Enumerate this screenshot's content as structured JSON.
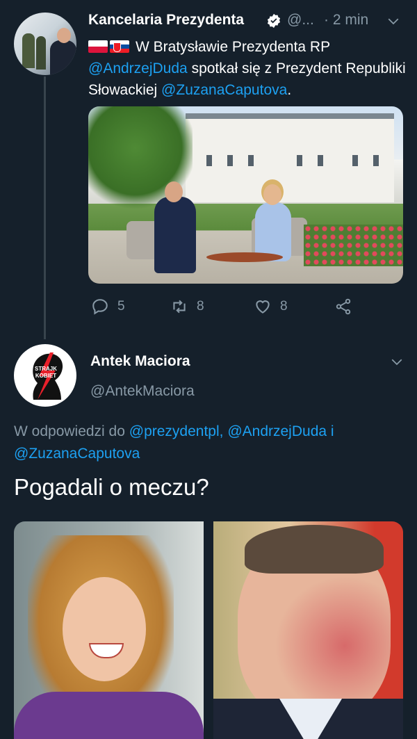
{
  "tweet1": {
    "author_name": "Kancelaria Prezydenta",
    "handle_truncated": "@...",
    "time": "· 2 min",
    "text_intro": "W Bratysławie Prezydenta RP",
    "mention1": "@AndrzejDuda",
    "text_mid": " spotkał się z Prezydent Republiki Słowackiej ",
    "mention2": "@ZuzanaCaputova",
    "text_end": ".",
    "flags": [
      "flag-poland-icon",
      "flag-slovakia-icon"
    ],
    "replies": "5",
    "retweets": "8",
    "likes": "8"
  },
  "tweet2": {
    "author_name": "Antek Maciora",
    "handle": "@AntekMaciora",
    "reply_prefix": "W odpowiedzi do ",
    "reply_mention1": "@prezydentpl",
    "reply_sep1": ", ",
    "reply_mention2": "@AndrzejDuda",
    "reply_sep2": " i ",
    "reply_mention3": "@ZuzanaCaputova",
    "text": "Pogadali o meczu?",
    "avatar_text_line1": "STRAJK",
    "avatar_text_line2": "KOBIET"
  },
  "colors": {
    "background": "#15202b",
    "link": "#1da1f2",
    "muted": "#8899a6",
    "verified": "#ffffff"
  }
}
